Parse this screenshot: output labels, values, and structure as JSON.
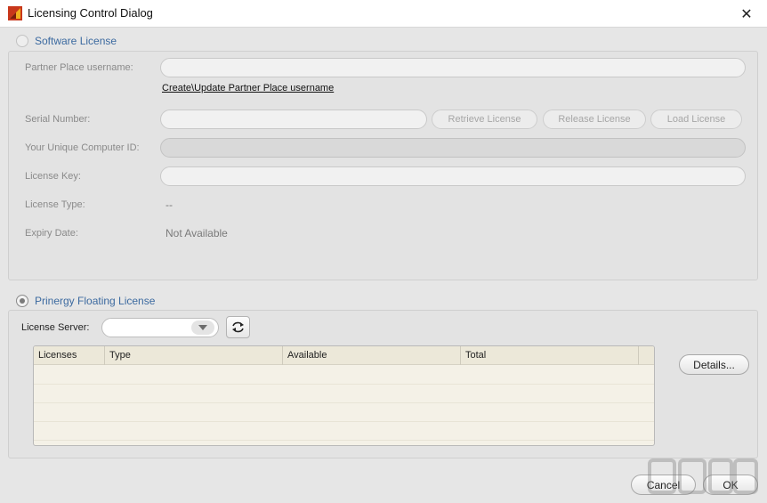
{
  "window": {
    "title": "Licensing Control Dialog",
    "close_glyph": "✕",
    "icon": "app-logo-icon"
  },
  "software_license": {
    "radio_label": "Software License",
    "selected": false,
    "partner_username_label": "Partner Place username:",
    "partner_username_value": "",
    "partner_link": "Create\\Update Partner Place username",
    "serial_label": "Serial Number:",
    "serial_value": "",
    "retrieve_label": "Retrieve License",
    "release_label": "Release License",
    "load_label": "Load License",
    "computer_id_label": "Your Unique Computer ID:",
    "computer_id_value": "",
    "license_key_label": "License Key:",
    "license_key_value": "",
    "license_type_label": "License Type:",
    "license_type_value": "--",
    "expiry_label": "Expiry Date:",
    "expiry_value": "Not Available"
  },
  "floating_license": {
    "radio_label": "Prinergy Floating License",
    "selected": true,
    "server_label": "License Server:",
    "server_value": "",
    "refresh_icon": "refresh-icon",
    "columns": [
      "Licenses",
      "Type",
      "Available",
      "Total"
    ],
    "rows": [],
    "details_label": "Details..."
  },
  "footer": {
    "cancel_label": "Cancel",
    "ok_label": "OK"
  },
  "colors": {
    "accent_label": "#3c6aa0",
    "table_bg": "#f4f1e7"
  }
}
